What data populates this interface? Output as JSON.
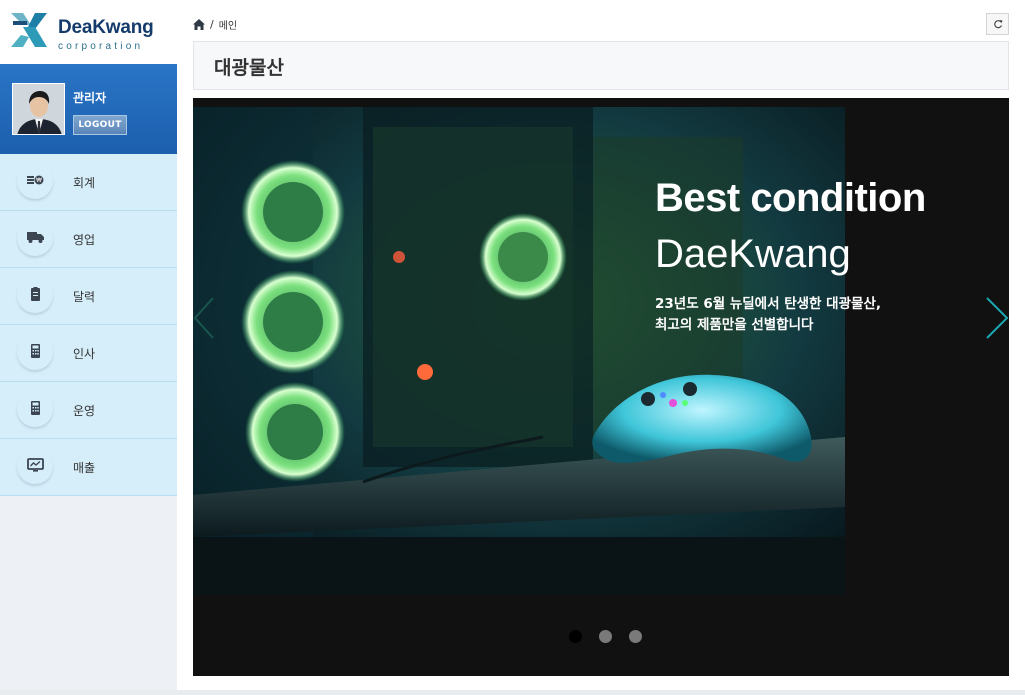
{
  "brand": {
    "name": "DeaKwang",
    "tagline": "corporation"
  },
  "user": {
    "name": "관리자",
    "logout_label": "LOGOUT"
  },
  "sidebar": {
    "items": [
      {
        "label": "회계",
        "icon": "accounting-icon"
      },
      {
        "label": "영업",
        "icon": "truck-icon"
      },
      {
        "label": "달력",
        "icon": "clipboard-icon"
      },
      {
        "label": "인사",
        "icon": "calculator-icon"
      },
      {
        "label": "운영",
        "icon": "calculator-icon"
      },
      {
        "label": "매출",
        "icon": "monitor-icon"
      }
    ]
  },
  "breadcrumb": {
    "home_icon": "home-icon",
    "separator": "/",
    "current": "메인"
  },
  "page": {
    "title": "대광물산"
  },
  "carousel": {
    "heading": "Best condition",
    "subheading": "DaeKwang",
    "desc_line1": "23년도 6월 뉴딜에서 탄생한 대광물산,",
    "desc_line2": "최고의 제품만을 선별합니다",
    "slide_count": 3,
    "active_index": 0
  },
  "colors": {
    "sidebar_profile_bg": "#2a75c6",
    "menu_bg": "#d6eefa",
    "arrow_color": "#1aa7b0",
    "brand_navy": "#143b6b"
  }
}
